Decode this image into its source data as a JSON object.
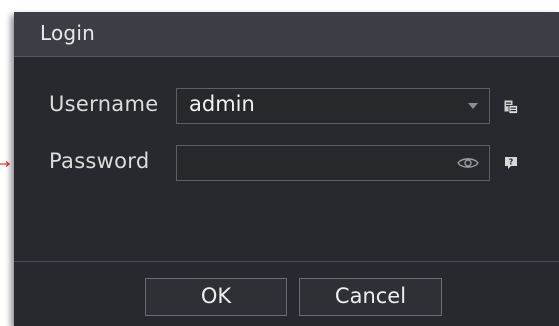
{
  "dialog": {
    "title": "Login"
  },
  "form": {
    "username_label": "Username",
    "username_value": "admin",
    "password_label": "Password",
    "password_value": ""
  },
  "buttons": {
    "ok_label": "OK",
    "cancel_label": "Cancel"
  },
  "icons": {
    "username_dropdown": "chevron-down-icon",
    "password_visibility": "eye-icon",
    "username_side": "user-list-icon",
    "password_side": "help-icon"
  },
  "colors": {
    "dialog_bg": "#27292e",
    "titlebar_bg": "#3b3e44",
    "text": "#dcdcdc",
    "field_border": "#5c5f66",
    "indicator_arrow": "#d9342b"
  }
}
